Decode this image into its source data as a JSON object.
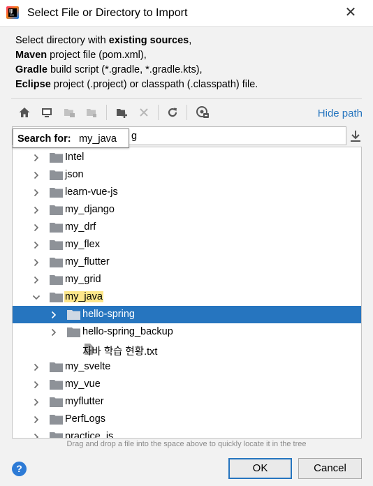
{
  "window": {
    "title": "Select File or Directory to Import",
    "close_symbol": "✕"
  },
  "description": {
    "line1": {
      "pre": "Select directory with ",
      "bold": "existing sources",
      "post": ","
    },
    "line2": {
      "bold": "Maven",
      "post": " project file (pom.xml),"
    },
    "line3": {
      "bold": "Gradle",
      "post": " build script (*.gradle, *.gradle.kts),"
    },
    "line4": {
      "bold": "Eclipse",
      "post": " project (.project) or classpath (.classpath) file."
    }
  },
  "toolbar": {
    "icons": [
      "home-icon",
      "desktop-icon",
      "project-folder-icon",
      "module-folder-icon",
      "new-folder-icon",
      "delete-icon",
      "refresh-icon",
      "show-hidden-icon"
    ],
    "hide_path_label": "Hide path"
  },
  "path_field": {
    "visible_tail": "g"
  },
  "search": {
    "label": "Search for:",
    "value": "my_java"
  },
  "tree": {
    "items": [
      {
        "label": "Intel",
        "type": "folder",
        "expanded": false,
        "highlighted": false,
        "selected": false
      },
      {
        "label": "json",
        "type": "folder",
        "expanded": false,
        "highlighted": false,
        "selected": false
      },
      {
        "label": "learn-vue-js",
        "type": "folder",
        "expanded": false,
        "highlighted": false,
        "selected": false
      },
      {
        "label": "my_django",
        "type": "folder",
        "expanded": false,
        "highlighted": false,
        "selected": false
      },
      {
        "label": "my_drf",
        "type": "folder",
        "expanded": false,
        "highlighted": false,
        "selected": false
      },
      {
        "label": "my_flex",
        "type": "folder",
        "expanded": false,
        "highlighted": false,
        "selected": false
      },
      {
        "label": "my_flutter",
        "type": "folder",
        "expanded": false,
        "highlighted": false,
        "selected": false
      },
      {
        "label": "my_grid",
        "type": "folder",
        "expanded": false,
        "highlighted": false,
        "selected": false
      },
      {
        "label": "my_java",
        "type": "folder",
        "expanded": true,
        "highlighted": true,
        "selected": false
      },
      {
        "label": "hello-spring",
        "type": "folder",
        "expanded": false,
        "highlighted": false,
        "selected": true
      },
      {
        "label": "hello-spring_backup",
        "type": "folder",
        "expanded": false,
        "highlighted": false,
        "selected": false
      },
      {
        "label": "자바 학습 현황.txt",
        "type": "file",
        "expanded": false,
        "highlighted": false,
        "selected": false
      },
      {
        "label": "my_svelte",
        "type": "folder",
        "expanded": false,
        "highlighted": false,
        "selected": false
      },
      {
        "label": "my_vue",
        "type": "folder",
        "expanded": false,
        "highlighted": false,
        "selected": false
      },
      {
        "label": "myflutter",
        "type": "folder",
        "expanded": false,
        "highlighted": false,
        "selected": false
      },
      {
        "label": "PerfLogs",
        "type": "folder",
        "expanded": false,
        "highlighted": false,
        "selected": false
      },
      {
        "label": "practice_js",
        "type": "folder",
        "expanded": false,
        "highlighted": false,
        "selected": false
      }
    ]
  },
  "hint": "Drag and drop a file into the space above to quickly locate it in the tree",
  "buttons": {
    "help": "?",
    "ok": "OK",
    "cancel": "Cancel"
  },
  "colors": {
    "accent": "#2675bf",
    "highlight": "#fde68a",
    "folder": "#8e9298"
  }
}
